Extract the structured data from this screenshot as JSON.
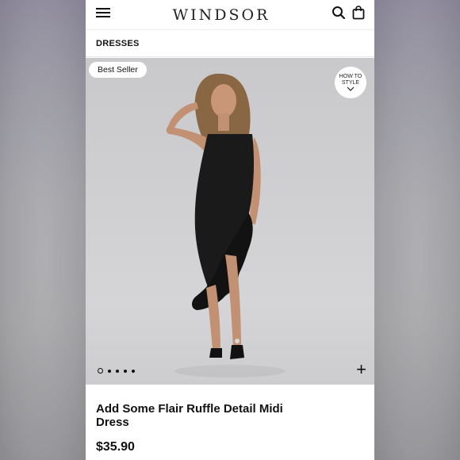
{
  "header": {
    "brand": "WINDSOR",
    "menu_icon": "hamburger-menu-icon",
    "search_icon": "search-icon",
    "bag_icon": "shopping-bag-icon"
  },
  "breadcrumb": "DRESSES",
  "product": {
    "badge": "Best Seller",
    "how_to_style": [
      "HOW TO",
      "STYLE"
    ],
    "carousel": {
      "count": 5,
      "active_index": 0
    },
    "title": "Add Some Flair Ruffle Detail Midi Dress",
    "price": "$35.90"
  },
  "colors": {
    "dress": "#1a1a1a",
    "background": "#cfcfd1"
  }
}
